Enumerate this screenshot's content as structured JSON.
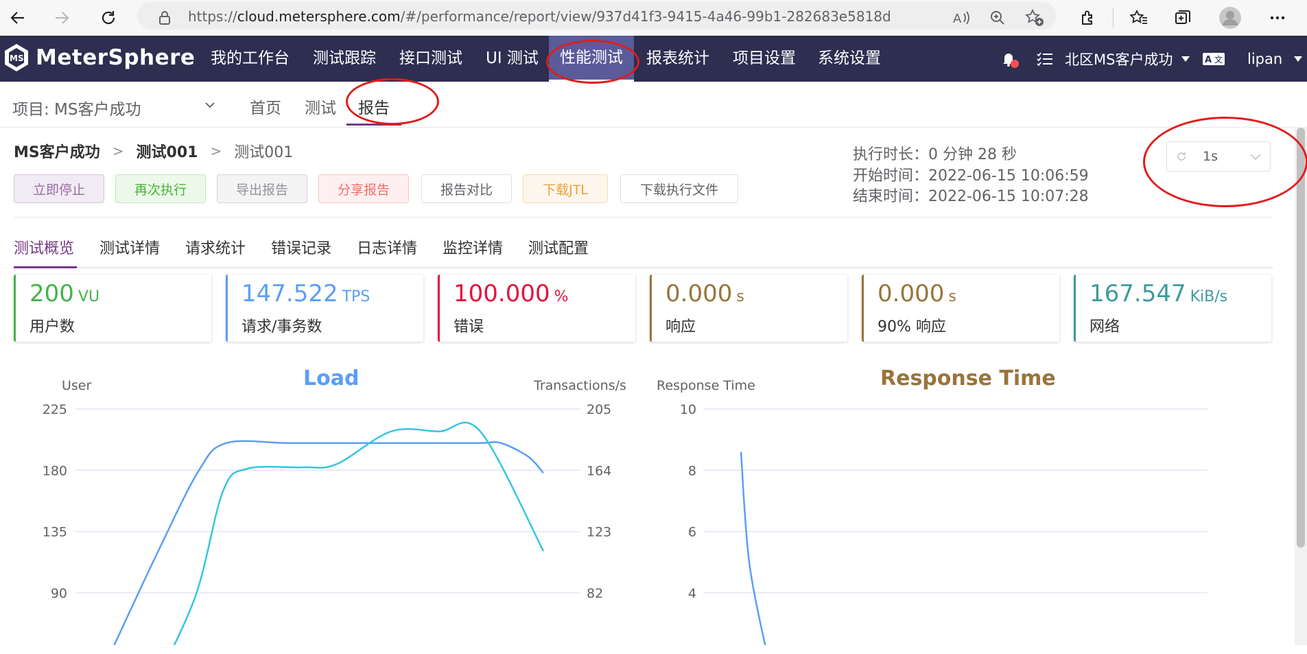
{
  "browser": {
    "url_prefix": "https://",
    "url_host": "cloud.metersphere.com",
    "url_path": "/#/performance/report/view/937d41f3-9415-4a46-99b1-282683e5818d"
  },
  "app": {
    "logo_text": "MeterSphere",
    "menu": [
      "我的工作台",
      "测试跟踪",
      "接口测试",
      "UI 测试",
      "性能测试",
      "报表统计",
      "项目设置",
      "系统设置"
    ],
    "workspace": "北区MS客户成功",
    "user": "lipan"
  },
  "subheader": {
    "project_label": "项目: MS客户成功",
    "tabs": [
      "首页",
      "测试",
      "报告"
    ]
  },
  "report": {
    "breadcrumb": [
      "MS客户成功",
      "测试001",
      "测试001"
    ],
    "buttons": [
      "立即停止",
      "再次执行",
      "导出报告",
      "分享报告",
      "报告对比",
      "下载JTL",
      "下载执行文件"
    ],
    "duration": "执行时长：0 分钟 28 秒",
    "start_time": "开始时间：2022-06-15 10:06:59",
    "end_time": "结束时间：2022-06-15 10:07:28",
    "refresh_interval": "1s",
    "tabs": [
      "测试概览",
      "测试详情",
      "请求统计",
      "错误记录",
      "日志详情",
      "监控详情",
      "测试配置"
    ]
  },
  "stats": [
    {
      "value": "200",
      "unit": "VU",
      "label": "用户数",
      "color": "#44b349"
    },
    {
      "value": "147.522",
      "unit": "TPS",
      "label": "请求/事务数",
      "color": "#5b9ef8"
    },
    {
      "value": "100.000",
      "unit": "%",
      "label": "错误",
      "color": "#e6113c"
    },
    {
      "value": "0.000",
      "unit": "s",
      "label": "响应",
      "color": "#99743c"
    },
    {
      "value": "0.000",
      "unit": "s",
      "label": "90% 响应",
      "color": "#99743c"
    },
    {
      "value": "167.547",
      "unit": "KiB/s",
      "label": "网络",
      "color": "#3d9b9c"
    }
  ],
  "charts": {
    "load_title": "Load",
    "load_y_left_name": "User",
    "load_y_right_name": "Transactions/s",
    "load_y_left_ticks": [
      "225",
      "180",
      "135",
      "90"
    ],
    "load_y_right_ticks": [
      "205",
      "164",
      "123",
      "82"
    ],
    "response_title": "Response Time",
    "response_y_name": "Response Time",
    "response_y_ticks": [
      "10",
      "8",
      "6",
      "4"
    ]
  },
  "chart_data": [
    {
      "type": "line",
      "title": "Load",
      "ylabel": "User",
      "y2label": "Transactions/s",
      "ylim": [
        45,
        225
      ],
      "y2lim": [
        41,
        205
      ],
      "series": [
        {
          "values": [
            50,
            120,
            180,
            200,
            200,
            200,
            200,
            200,
            200,
            190,
            178
          ]
        },
        {
          "values": [
            20,
            80,
            150,
            165,
            166,
            168,
            190,
            190,
            190,
            110
          ]
        }
      ]
    },
    {
      "type": "line",
      "title": "Response Time",
      "ylabel": "Response Time",
      "ylim": [
        2,
        10
      ],
      "series": [
        {
          "values": [
            8.6,
            5.0,
            2.0
          ]
        }
      ]
    }
  ]
}
